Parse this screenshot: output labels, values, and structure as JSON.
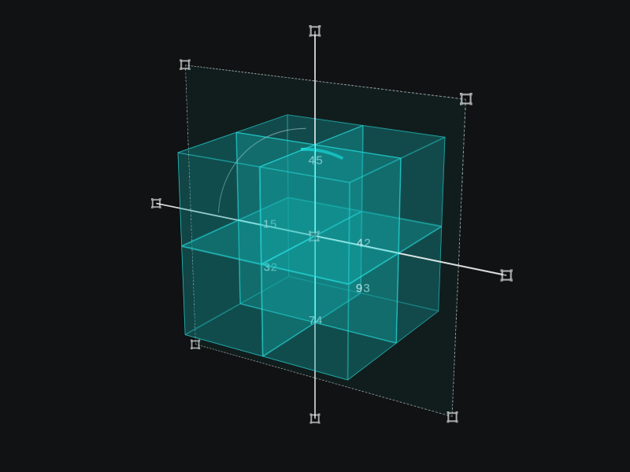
{
  "labels": {
    "top": "45",
    "left": "15",
    "right": "42",
    "center": " ",
    "bl": "32",
    "br": "93",
    "bottom": "74"
  },
  "colors": {
    "bg": "#101213",
    "cubeFill": "rgba(18,170,170,0.18)",
    "cubeEdge": "rgba(40,230,230,0.55)",
    "accent": "#19d6d6"
  }
}
